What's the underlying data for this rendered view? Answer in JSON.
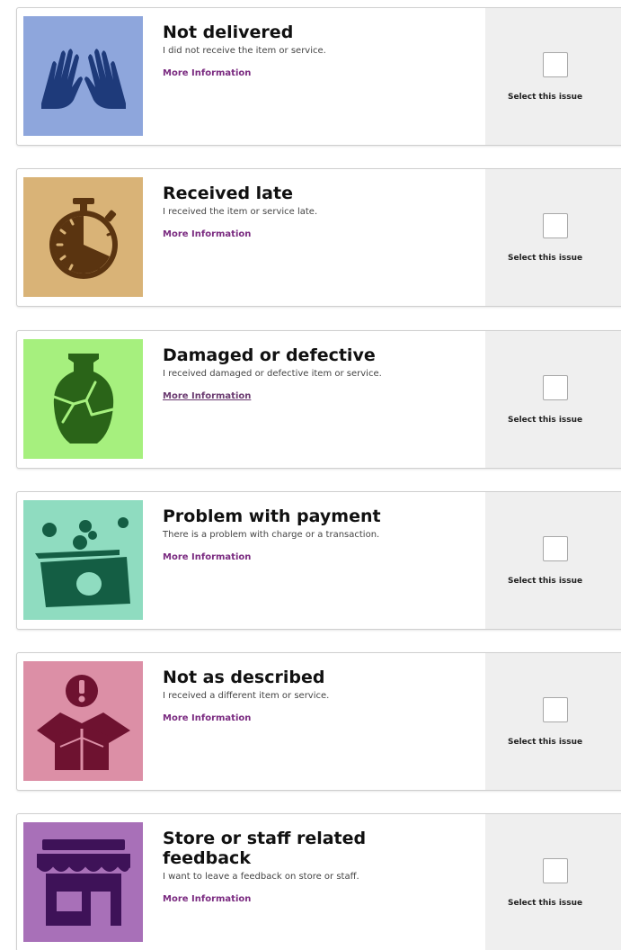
{
  "issues": [
    {
      "title": "Not delivered",
      "description": "I did not receive the item or service.",
      "more_info": "More Information",
      "select_label": "Select this issue",
      "icon": "hands-icon",
      "icon_bg": "#8ea6dc",
      "icon_fg": "#1e3a7a"
    },
    {
      "title": "Received late",
      "description": "I received the item or service late.",
      "more_info": "More Information",
      "select_label": "Select this issue",
      "icon": "stopwatch-icon",
      "icon_bg": "#d9b377",
      "icon_fg": "#5a3410"
    },
    {
      "title": "Damaged or defective",
      "description": "I received damaged or defective item or service.",
      "more_info": "More Information",
      "select_label": "Select this issue",
      "icon": "broken-vase-icon",
      "icon_bg": "#a6f07e",
      "icon_fg": "#2a6418"
    },
    {
      "title": "Problem with payment",
      "description": "There is a problem with charge or a transaction.",
      "more_info": "More Information",
      "select_label": "Select this issue",
      "icon": "money-coins-icon",
      "icon_bg": "#8fdcc0",
      "icon_fg": "#145e44"
    },
    {
      "title": "Not as described",
      "description": "I received a different item or service.",
      "more_info": "More Information",
      "select_label": "Select this issue",
      "icon": "open-box-alert-icon",
      "icon_bg": "#dc8fa6",
      "icon_fg": "#6e1230"
    },
    {
      "title": "Store or staff related feedback",
      "description": "I want to leave a feedback on store or staff.",
      "more_info": "More Information",
      "select_label": "Select this issue",
      "icon": "storefront-icon",
      "icon_bg": "#a870b8",
      "icon_fg": "#3e1258"
    }
  ]
}
